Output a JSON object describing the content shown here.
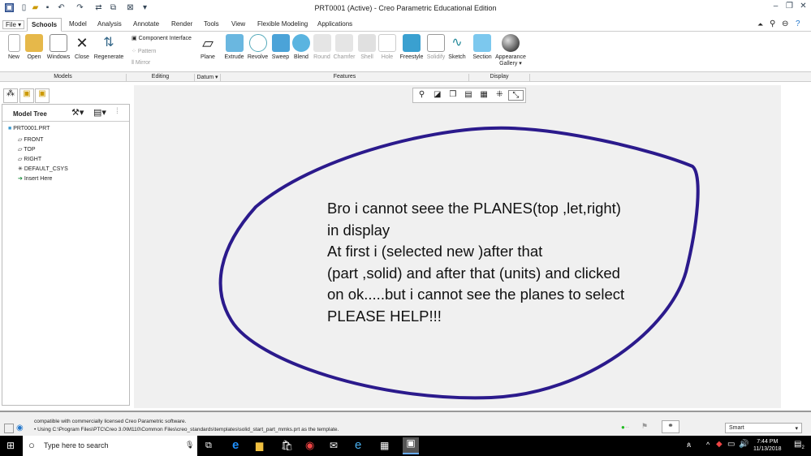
{
  "window": {
    "title": "PRT0001 (Active) - Creo Parametric Educational Edition"
  },
  "tabs": [
    "File ▾",
    "Schools",
    "Model",
    "Analysis",
    "Annotate",
    "Render",
    "Tools",
    "View",
    "Flexible Modeling",
    "Applications"
  ],
  "ribbon": {
    "models": [
      "New",
      "Open",
      "Windows",
      "Close",
      "Regenerate"
    ],
    "editing": [
      "Component Interface",
      "Pattern",
      "Mirror"
    ],
    "datum": [
      "Plane"
    ],
    "features": [
      "Extrude",
      "Revolve",
      "Sweep",
      "Blend",
      "Round",
      "Chamfer",
      "Shell",
      "Hole",
      "Freestyle",
      "Solidify",
      "Sketch"
    ],
    "display": [
      "Section",
      "Appearance Gallery ▾"
    ],
    "groups": [
      "Models",
      "Editing",
      "Datum ▾",
      "Features",
      "Display"
    ]
  },
  "panel": {
    "title": "Model Tree",
    "items": [
      "PRT0001.PRT",
      "FRONT",
      "TOP",
      "RIGHT",
      "DEFAULT_CSYS",
      "Insert Here"
    ]
  },
  "annotation": {
    "lines": [
      "Bro i cannot seee the PLANES(top ,let,right)",
      "in display",
      "At first i (selected new )after that",
      "(part ,solid) and after that (units) and clicked",
      "on ok.....but i cannot see the planes to select",
      "PLEASE HELP!!!"
    ],
    "color": "#2b1a8c"
  },
  "status": {
    "line1": "compatible with commercially licensed Creo Parametric software.",
    "line2": "• Using C:\\Program Files\\PTC\\Creo 3.0\\M110\\Common Files\\creo_standards\\templates\\solid_start_part_mmks.prt as the template.",
    "filter": "Smart"
  },
  "taskbar": {
    "search": "Type here to search",
    "time": "7:44 PM",
    "date": "11/13/2018",
    "notifications": "2"
  }
}
